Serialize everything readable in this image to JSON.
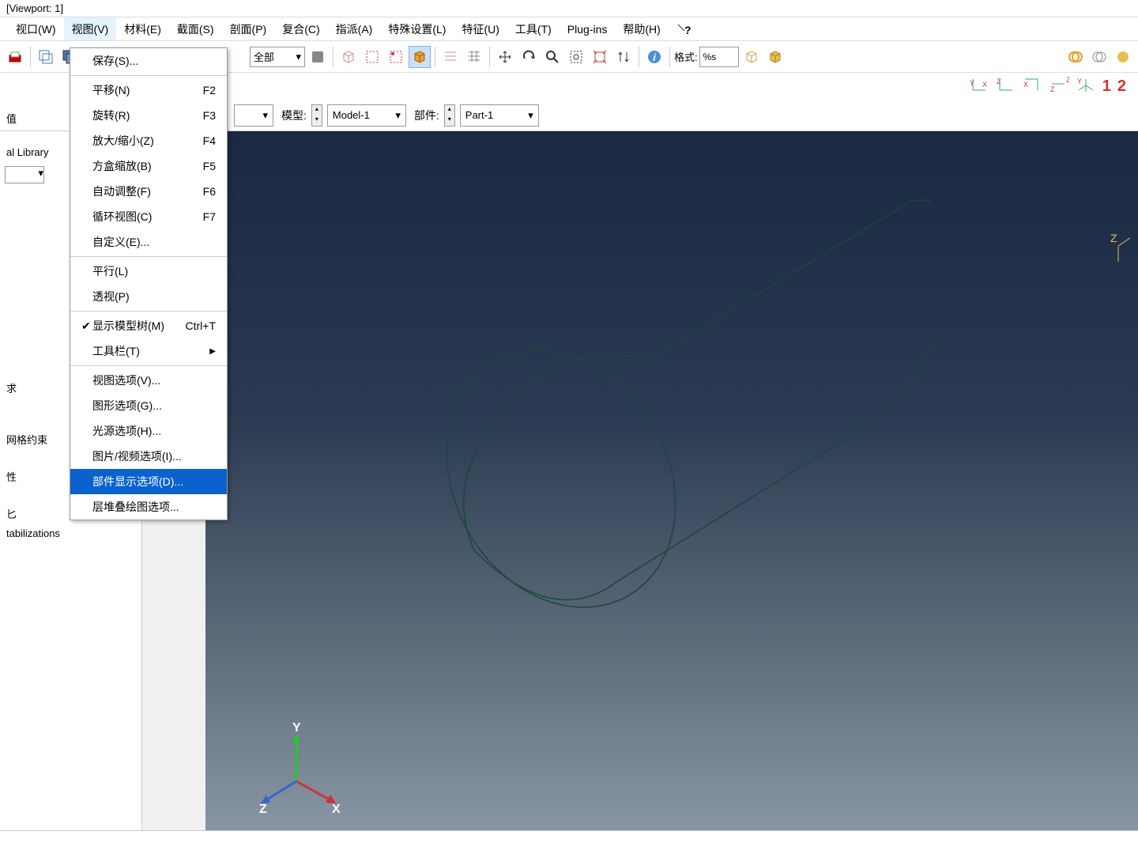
{
  "window": {
    "title": "[Viewport: 1]"
  },
  "menubar": {
    "items": [
      {
        "label": "视口(W)",
        "u": "W"
      },
      {
        "label": "视图(V)",
        "u": "V"
      },
      {
        "label": "材料(E)",
        "u": "E"
      },
      {
        "label": "截面(S)",
        "u": "S"
      },
      {
        "label": "剖面(P)",
        "u": "P"
      },
      {
        "label": "复合(C)",
        "u": "C"
      },
      {
        "label": "指派(A)",
        "u": "A"
      },
      {
        "label": "特殊设置(L)",
        "u": "L"
      },
      {
        "label": "特征(U)",
        "u": "U"
      },
      {
        "label": "工具(T)",
        "u": "T"
      },
      {
        "label": "Plug-ins",
        "u": ""
      },
      {
        "label": "帮助(H)",
        "u": "H"
      }
    ]
  },
  "dropdown": {
    "items": [
      {
        "label": "保存(S)...",
        "shortcut": "",
        "type": "item"
      },
      {
        "type": "sep"
      },
      {
        "label": "平移(N)",
        "shortcut": "F2",
        "type": "item"
      },
      {
        "label": "旋转(R)",
        "shortcut": "F3",
        "type": "item"
      },
      {
        "label": "放大/缩小(Z)",
        "shortcut": "F4",
        "type": "item"
      },
      {
        "label": "方盒缩放(B)",
        "shortcut": "F5",
        "type": "item"
      },
      {
        "label": "自动调整(F)",
        "shortcut": "F6",
        "type": "item"
      },
      {
        "label": "循环视图(C)",
        "shortcut": "F7",
        "type": "item"
      },
      {
        "label": "自定义(E)...",
        "shortcut": "",
        "type": "item"
      },
      {
        "type": "sep"
      },
      {
        "label": "平行(L)",
        "shortcut": "",
        "type": "item"
      },
      {
        "label": "透视(P)",
        "shortcut": "",
        "type": "item"
      },
      {
        "type": "sep"
      },
      {
        "label": "显示模型树(M)",
        "shortcut": "Ctrl+T",
        "type": "item",
        "checked": true
      },
      {
        "label": "工具栏(T)",
        "shortcut": "",
        "type": "submenu"
      },
      {
        "type": "sep"
      },
      {
        "label": "视图选项(V)...",
        "shortcut": "",
        "type": "item"
      },
      {
        "label": "图形选项(G)...",
        "shortcut": "",
        "type": "item"
      },
      {
        "label": "光源选项(H)...",
        "shortcut": "",
        "type": "item"
      },
      {
        "label": "图片/视频选项(I)...",
        "shortcut": "",
        "type": "item"
      },
      {
        "label": "部件显示选项(D)...",
        "shortcut": "",
        "type": "item",
        "highlighted": true
      },
      {
        "label": "层堆叠绘图选项...",
        "shortcut": "",
        "type": "item"
      }
    ]
  },
  "toolbar": {
    "select_all": "全部",
    "format_label": "格式:",
    "format_value": "%s"
  },
  "toolbar2": {
    "nav_labels": [
      "1",
      "2"
    ]
  },
  "context": {
    "model_label": "模型:",
    "model_value": "Model-1",
    "part_label": "部件:",
    "part_value": "Part-1"
  },
  "tree": {
    "items": [
      "值",
      "al Library",
      "求",
      "",
      "",
      "网格约束",
      "",
      "性",
      "",
      "",
      "tabilizations"
    ]
  },
  "triad": {
    "x": "X",
    "y": "Y",
    "z": "Z"
  },
  "palette_xyz": "(XYZ)"
}
